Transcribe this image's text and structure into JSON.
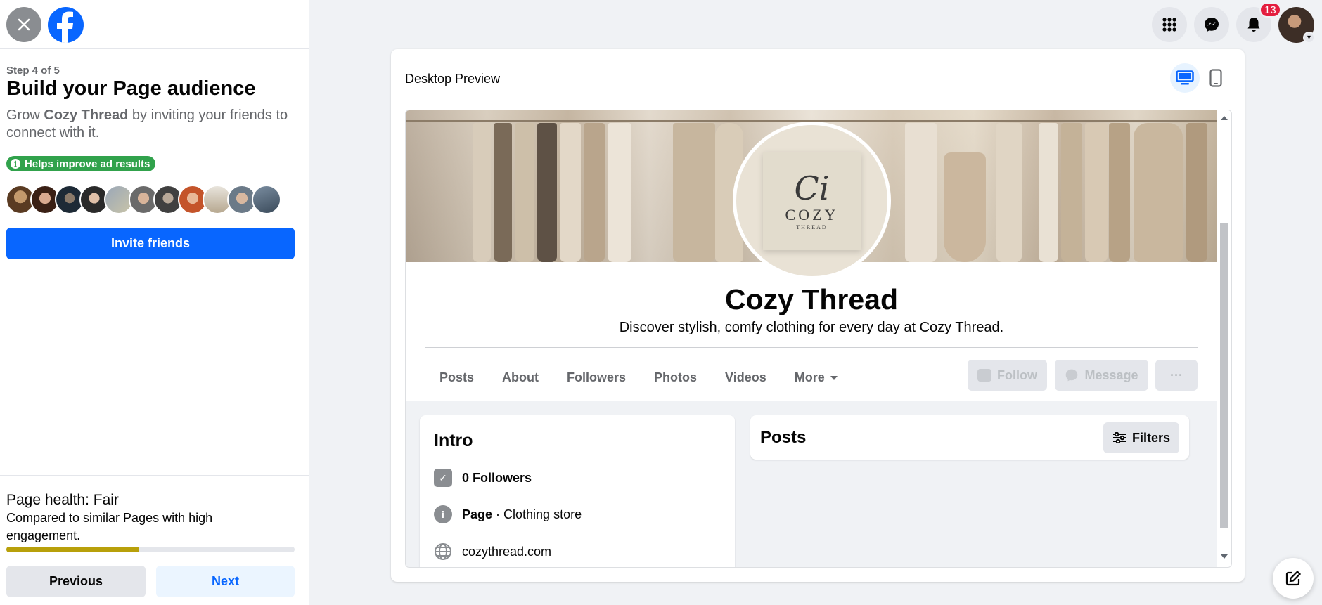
{
  "left_panel": {
    "step": "Step 4 of 5",
    "title": "Build your Page audience",
    "desc_prefix": "Grow ",
    "desc_page": "Cozy Thread",
    "desc_suffix": " by inviting your friends to connect with it.",
    "badge": "Helps improve ad results",
    "invite_button": "Invite friends",
    "health_title": "Page health: Fair",
    "health_desc": "Compared to similar Pages with high engagement.",
    "health_progress": 0.46,
    "previous_button": "Previous",
    "next_button": "Next"
  },
  "topbar": {
    "notification_count": "13",
    "icons": [
      "menu-grid-icon",
      "messenger-icon",
      "bell-icon"
    ]
  },
  "preview": {
    "title": "Desktop Preview",
    "page_name": "Cozy Thread",
    "page_desc": "Discover stylish, comfy clothing for every day at Cozy Thread.",
    "logo_script": "Ci",
    "logo_text": "COZY",
    "logo_sub": "THREAD",
    "tabs": [
      "Posts",
      "About",
      "Followers",
      "Photos",
      "Videos",
      "More"
    ],
    "follow_button": "Follow",
    "message_button": "Message",
    "more_button": "···",
    "intro": {
      "title": "Intro",
      "followers": "0 Followers",
      "category_bold": "Page",
      "category_rest": " · Clothing store",
      "website": "cozythread.com"
    },
    "posts_title": "Posts",
    "filters_button": "Filters"
  },
  "colors": {
    "brand_blue": "#0866ff",
    "ad_badge_green": "#31a24c",
    "health_bar": "#b8a00a",
    "notification_red": "#e41e3f"
  }
}
